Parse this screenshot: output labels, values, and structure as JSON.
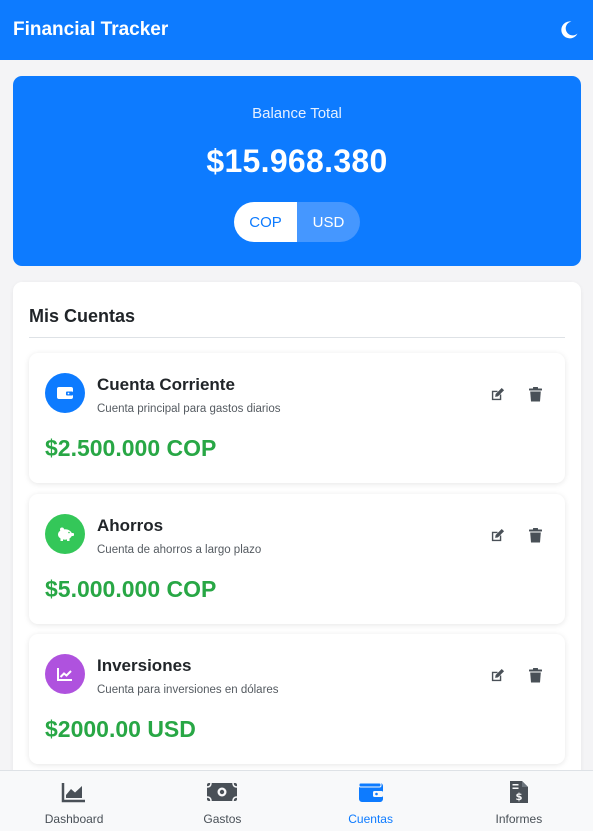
{
  "header": {
    "title": "Financial Tracker",
    "theme_icon": "moon-icon"
  },
  "balance": {
    "label": "Balance Total",
    "value": "$15.968.380",
    "currencies": [
      "COP",
      "USD"
    ],
    "selected": "COP"
  },
  "accounts": {
    "title": "Mis Cuentas",
    "items": [
      {
        "name": "Cuenta Corriente",
        "description": "Cuenta principal para gastos diarios",
        "amount": "$2.500.000 COP",
        "icon": "wallet-icon",
        "color": "#0d7bff"
      },
      {
        "name": "Ahorros",
        "description": "Cuenta de ahorros a largo plazo",
        "amount": "$5.000.000 COP",
        "icon": "piggy-bank-icon",
        "color": "#34c759"
      },
      {
        "name": "Inversiones",
        "description": "Cuenta para inversiones en dólares",
        "amount": "$2000.00 USD",
        "icon": "chart-line-icon",
        "color": "#af52de"
      }
    ]
  },
  "nav": {
    "items": [
      {
        "label": "Dashboard",
        "icon": "chart-area-icon"
      },
      {
        "label": "Gastos",
        "icon": "money-bill-icon"
      },
      {
        "label": "Cuentas",
        "icon": "wallet-icon"
      },
      {
        "label": "Informes",
        "icon": "invoice-dollar-icon"
      }
    ],
    "active": "Cuentas"
  },
  "colors": {
    "primary": "#0d7bff",
    "success": "#28a745"
  }
}
